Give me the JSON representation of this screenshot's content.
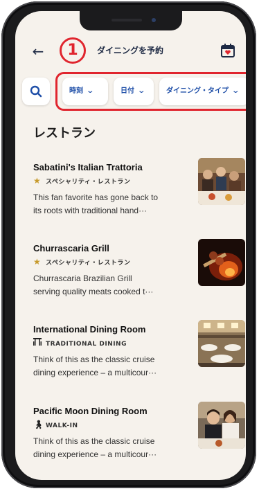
{
  "header": {
    "title": "ダイニングを予約",
    "step_badge": "1"
  },
  "filters": [
    {
      "label": "時刻",
      "chevron": "⌄"
    },
    {
      "label": "日付",
      "chevron": "⌄"
    },
    {
      "label": "ダイニング・タイプ",
      "chevron": "⌄"
    }
  ],
  "section_title": "レストラン",
  "restaurants": [
    {
      "name": "Sabatini's Italian Trattoria",
      "category": "スペシャリティ・レストラン",
      "category_icon": "star-icon",
      "desc_line1": "This fan favorite has gone back to",
      "desc_line2": "its roots with traditional hand···"
    },
    {
      "name": "Churrascaria Grill",
      "category": "スペシャリティ・レストラン",
      "category_icon": "star-icon",
      "desc_line1": "Churrascaria Brazilian Grill",
      "desc_line2": "serving quality meats cooked t···"
    },
    {
      "name": "International Dining Room",
      "category": "TRADITIONAL DINING",
      "category_icon": "dining-table-icon",
      "desc_line1": "Think of this as the classic cruise",
      "desc_line2": "dining experience – a multicour···"
    },
    {
      "name": "Pacific Moon Dining Room",
      "category": "WALK-IN",
      "category_icon": "walking-person-icon",
      "desc_line1": "Think of this as the classic cruise",
      "desc_line2": "dining experience – a multicour···"
    }
  ],
  "colors": {
    "accent": "#1f4fa8",
    "highlight": "#e0252e",
    "background": "#f6f2ec",
    "star": "#c79a2b"
  }
}
